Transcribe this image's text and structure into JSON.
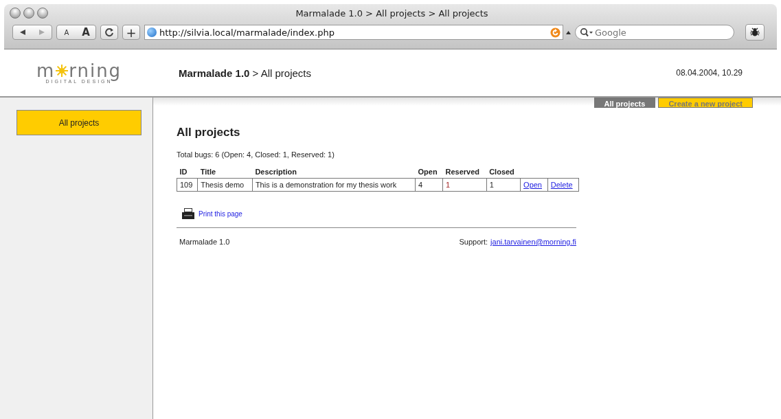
{
  "window": {
    "title": "Marmalade 1.0 > All projects > All projects"
  },
  "toolbar": {
    "url": "http://silvia.local/marmalade/index.php",
    "search": {
      "placeholder": "Google"
    },
    "text_smaller": "A",
    "text_bigger": "A",
    "add": "+"
  },
  "header": {
    "logo": {
      "left": "m",
      "right": "rning",
      "tagline": "DIGITAL DESIGN"
    },
    "breadcrumb": {
      "app": "Marmalade 1.0",
      "separator": ">",
      "page": "All projects"
    },
    "date": "08.04.2004, 10.29"
  },
  "sidebar": {
    "items": [
      {
        "label": "All projects",
        "selected": true
      }
    ]
  },
  "tabs": [
    {
      "label": "All projects",
      "selected": true
    },
    {
      "label": "Create a new project",
      "selected": false
    }
  ],
  "content": {
    "title": "All projects",
    "summary": "Total bugs: 6 (Open: 4, Closed: 1, Reserved: 1)",
    "table": {
      "columns": [
        "ID",
        "Title",
        "Description",
        "Open",
        "Reserved",
        "Closed"
      ],
      "rows": [
        {
          "cells": [
            "109",
            "Thesis demo",
            "This is a demonstration for my thesis work",
            "4",
            "1",
            "1"
          ],
          "actions": [
            "Open",
            "Delete"
          ]
        }
      ]
    },
    "print_link": "Print this page"
  },
  "footer": {
    "version": "Marmalade 1.0",
    "support_label": "Support:",
    "email": "jani.tarvainen@morning.fi"
  }
}
